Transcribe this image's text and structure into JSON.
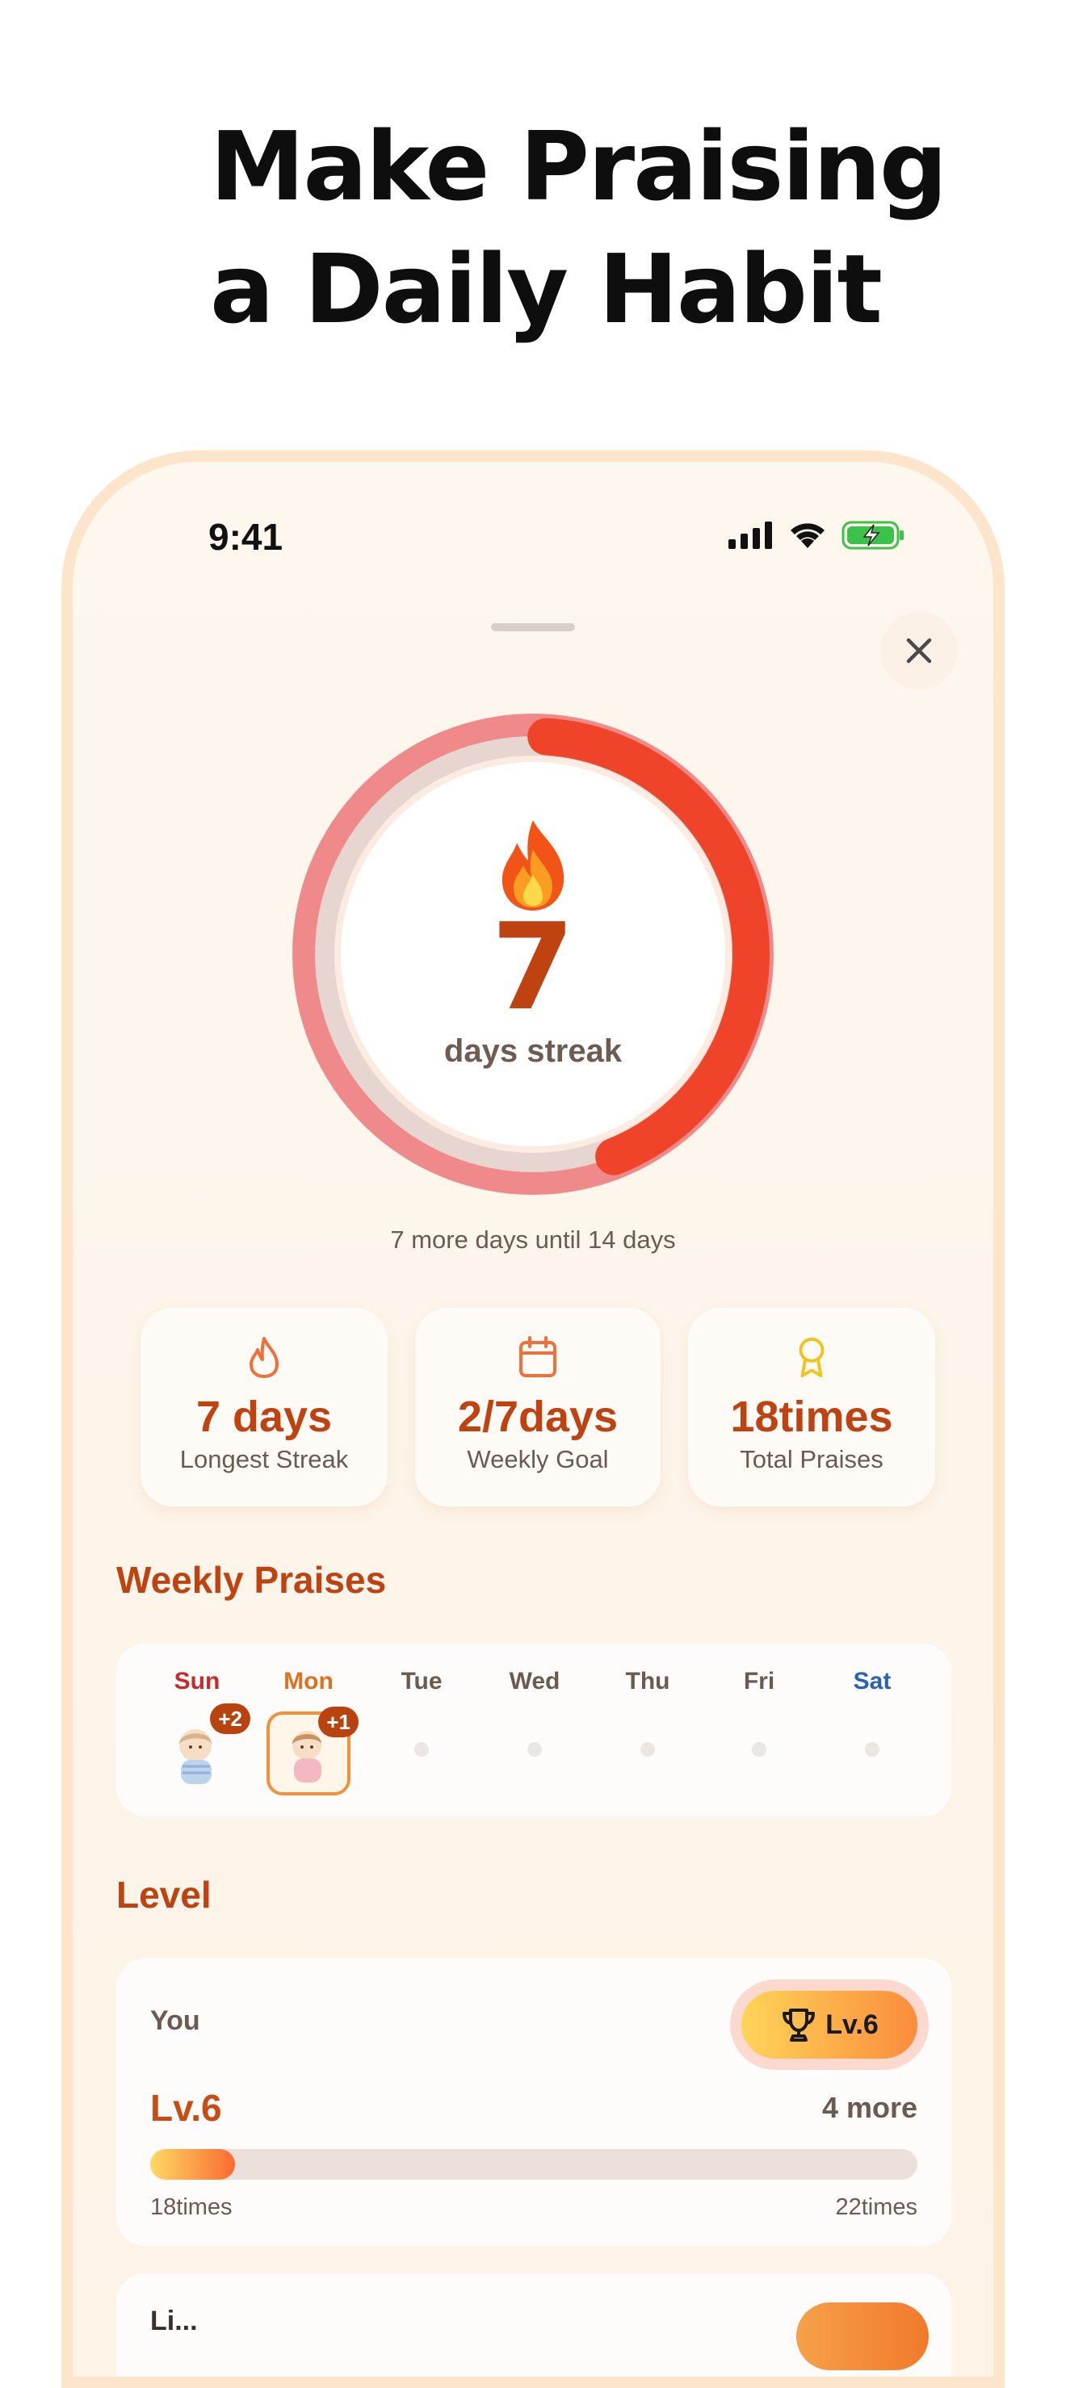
{
  "headline": {
    "line1": "Make Praising",
    "line2": "a Daily Habit"
  },
  "status_bar": {
    "time": "9:41"
  },
  "streak": {
    "count": "7",
    "label": "days streak",
    "subtitle": "7 more days until 14 days",
    "progress_fraction": 0.5,
    "colors": {
      "ring_outer": "#f08a8a",
      "ring_track": "#e6d6cf",
      "ring_progress": "#f0442a",
      "number": "#bf4211"
    }
  },
  "stats": [
    {
      "icon": "flame-icon",
      "value": "7 days",
      "label": "Longest Streak"
    },
    {
      "icon": "calendar-icon",
      "value": "2/7days",
      "label": "Weekly Goal"
    },
    {
      "icon": "award-ribbon-icon",
      "value": "18times",
      "label": "Total Praises"
    }
  ],
  "weekly": {
    "title": "Weekly Praises",
    "days": [
      {
        "label": "Sun",
        "color": "#c72a2a",
        "badge": "+2"
      },
      {
        "label": "Mon",
        "color": "#e0701e",
        "badge": "+1"
      },
      {
        "label": "Tue",
        "color": "#6b5a52"
      },
      {
        "label": "Wed",
        "color": "#6b5a52"
      },
      {
        "label": "Thu",
        "color": "#6b5a52"
      },
      {
        "label": "Fri",
        "color": "#6b5a52"
      },
      {
        "label": "Sat",
        "color": "#2a62b8"
      }
    ]
  },
  "level": {
    "title": "Level",
    "user_label": "You",
    "badge_label": "Lv.6",
    "current_level": "Lv.6",
    "remaining": "4 more",
    "progress_fraction": 0.11,
    "range_min": "18times",
    "range_max": "22times"
  },
  "next_card": {
    "label": "Li..."
  }
}
